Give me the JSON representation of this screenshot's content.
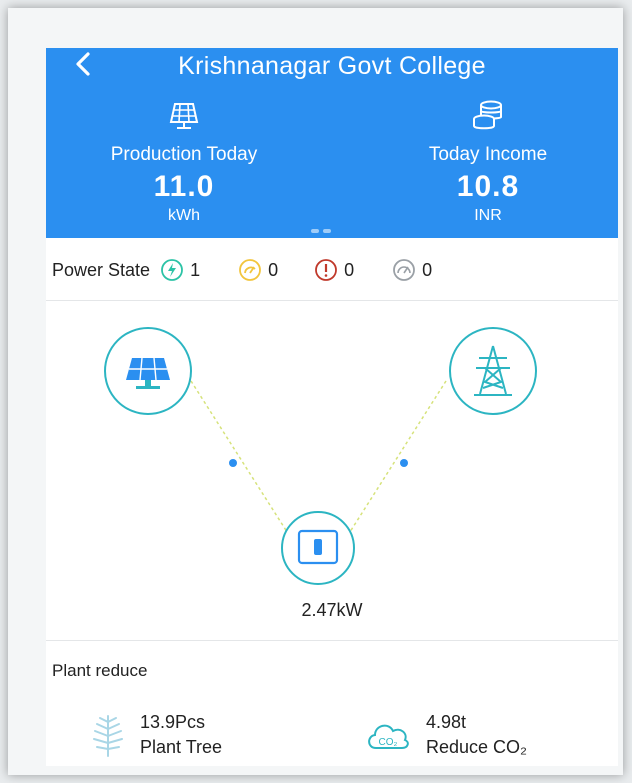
{
  "header": {
    "title": "Krishnanagar Govt College",
    "back_icon": "chevron-left-icon",
    "bg_color": "#2b8ff0"
  },
  "stats": [
    {
      "icon": "solar-panel-icon",
      "label": "Production Today",
      "value": "11.0",
      "unit": "kWh"
    },
    {
      "icon": "coins-icon",
      "label": "Today Income",
      "value": "10.8",
      "unit": "INR"
    }
  ],
  "power_state": {
    "label": "Power State",
    "states": [
      {
        "icon": "normal-lightning-icon",
        "count": "1",
        "color": "#2cc3a6"
      },
      {
        "icon": "standby-icon",
        "count": "0",
        "color": "#f2c53d"
      },
      {
        "icon": "fault-icon",
        "count": "0",
        "color": "#c0392b"
      },
      {
        "icon": "offline-icon",
        "count": "0",
        "color": "#9aa0a6"
      }
    ]
  },
  "flow": {
    "nodes": [
      "solar-panel-icon",
      "grid-tower-icon",
      "inverter-icon"
    ],
    "power": "2.47kW",
    "accent": "#2cb5c2"
  },
  "plant_reduce": {
    "title": "Plant reduce",
    "items": [
      {
        "icon": "tree-icon",
        "value": "13.9Pcs",
        "label": "Plant Tree"
      },
      {
        "icon": "co2-cloud-icon",
        "value": "4.98t",
        "label": "Reduce CO₂"
      }
    ]
  }
}
